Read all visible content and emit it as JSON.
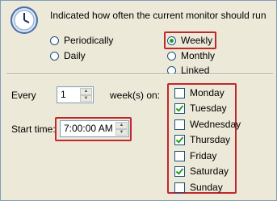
{
  "header": {
    "description": "Indicated how often the current monitor should run",
    "icon": "clock-icon"
  },
  "frequency": {
    "options": [
      {
        "label": "Periodically",
        "selected": false
      },
      {
        "label": "Daily",
        "selected": false
      },
      {
        "label": "Weekly",
        "selected": true
      },
      {
        "label": "Monthly",
        "selected": false
      },
      {
        "label": "Linked",
        "selected": false
      }
    ]
  },
  "every": {
    "label": "Every",
    "value": "1",
    "unit_label": "week(s) on:"
  },
  "start_time": {
    "label": "Start time:",
    "value": "7:00:00 AM"
  },
  "days": [
    {
      "label": "Monday",
      "checked": false
    },
    {
      "label": "Tuesday",
      "checked": true
    },
    {
      "label": "Wednesday",
      "checked": false
    },
    {
      "label": "Thursday",
      "checked": true
    },
    {
      "label": "Friday",
      "checked": false
    },
    {
      "label": "Saturday",
      "checked": true
    },
    {
      "label": "Sunday",
      "checked": false
    }
  ],
  "colors": {
    "highlight": "#c0282c",
    "check": "#21a121",
    "background": "#ece9d8"
  }
}
